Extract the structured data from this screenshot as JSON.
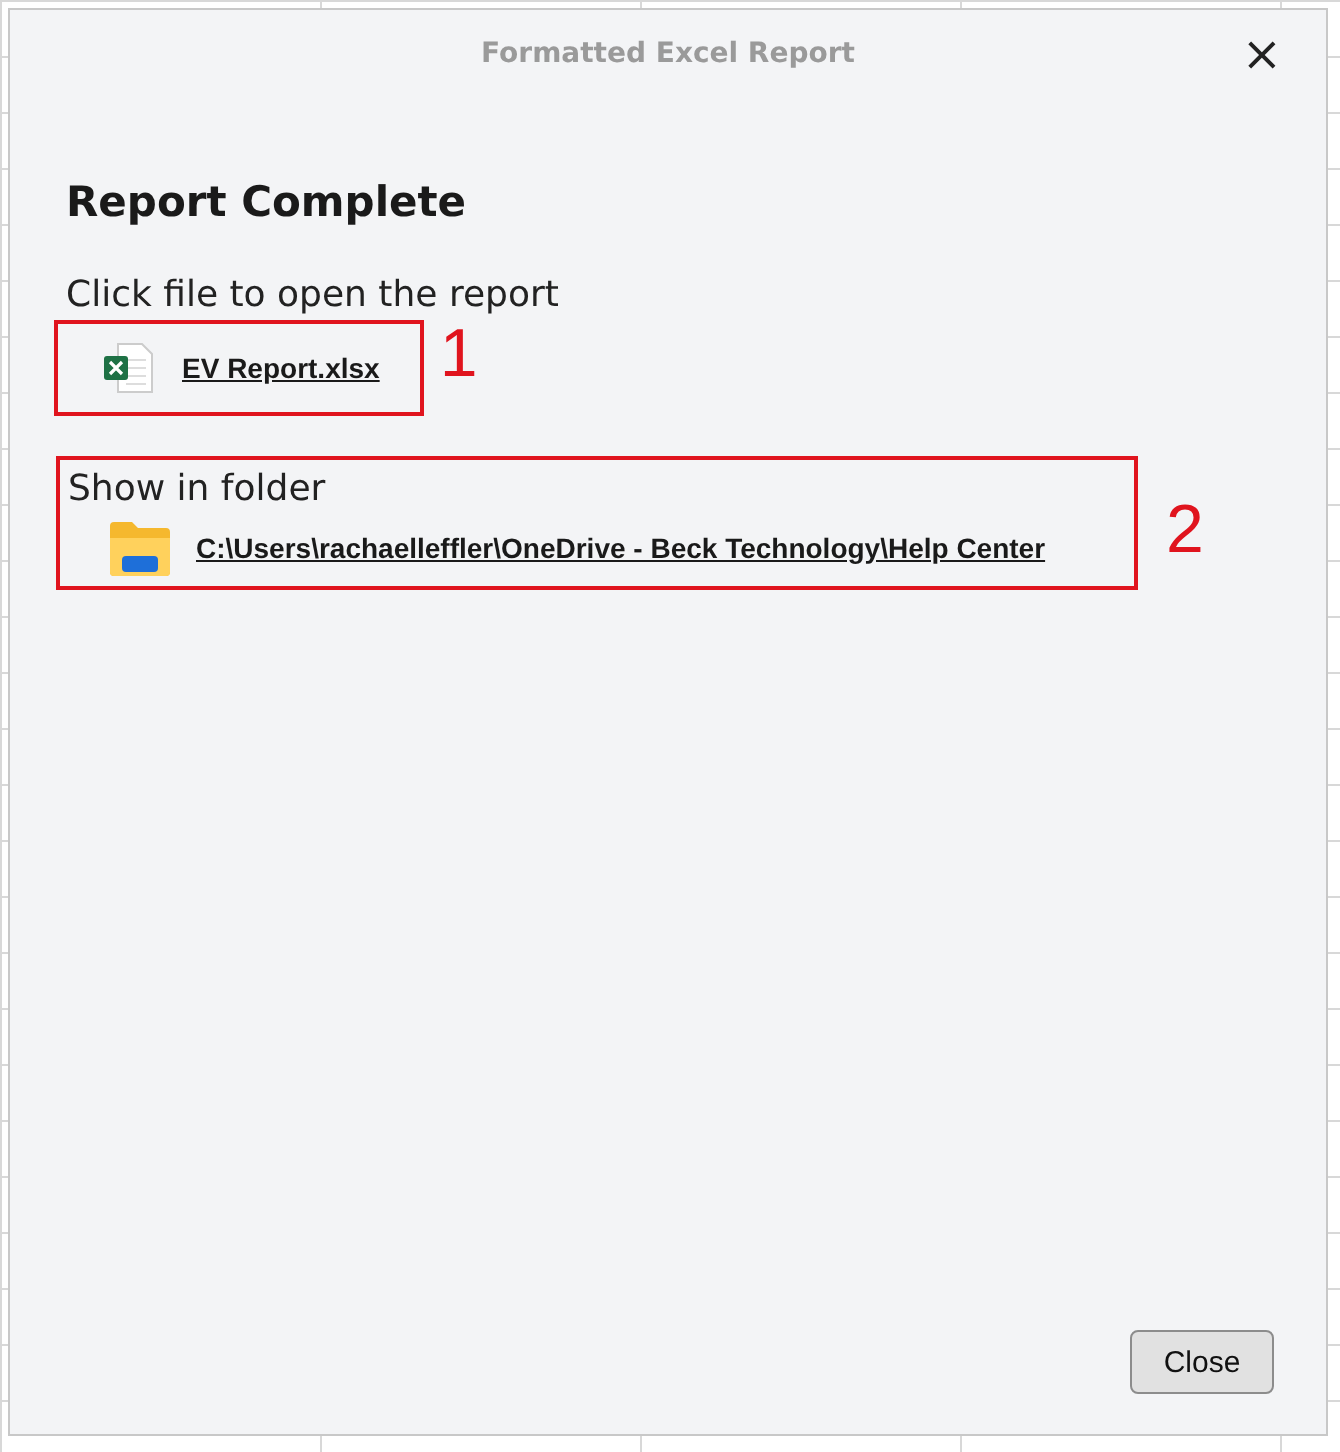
{
  "window": {
    "title": "Formatted Excel Report",
    "close_glyph": "×"
  },
  "heading": "Report Complete",
  "file_section": {
    "label": "Click file to open the report",
    "link": "EV Report.xlsx",
    "callout": "1"
  },
  "folder_section": {
    "label": "Show in folder",
    "link": "C:\\Users\\rachaelleffler\\OneDrive - Beck Technology\\Help Center",
    "callout": "2"
  },
  "buttons": [
    "Close"
  ]
}
